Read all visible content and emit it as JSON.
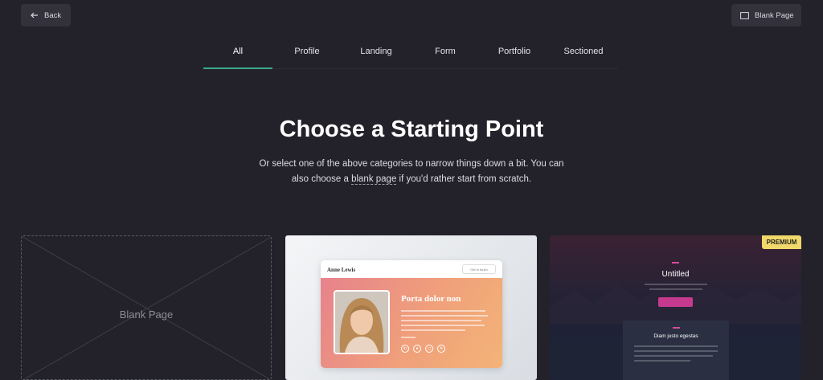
{
  "toolbar": {
    "back_label": "Back",
    "blank_page_label": "Blank Page"
  },
  "tabs": [
    {
      "label": "All",
      "active": true
    },
    {
      "label": "Profile",
      "active": false
    },
    {
      "label": "Landing",
      "active": false
    },
    {
      "label": "Form",
      "active": false
    },
    {
      "label": "Portfolio",
      "active": false
    },
    {
      "label": "Sectioned",
      "active": false
    }
  ],
  "hero": {
    "title": "Choose a Starting Point",
    "subtitle_before": "Or select one of the above categories to narrow things down a bit. You can also choose a ",
    "subtitle_link": "blank page",
    "subtitle_after": " if you'd rather start from scratch."
  },
  "templates": {
    "blank": {
      "label": "Blank Page"
    },
    "profile": {
      "name": "Anne Lewis",
      "button": "Get in touch",
      "heading": "Porta dolor non"
    },
    "untitled": {
      "badge": "PREMIUM",
      "title": "Untitled",
      "panel_title": "Diam justo egestas"
    }
  },
  "colors": {
    "background": "#23222b",
    "accent": "#38a98c",
    "premium_badge": "#f0d86a"
  }
}
